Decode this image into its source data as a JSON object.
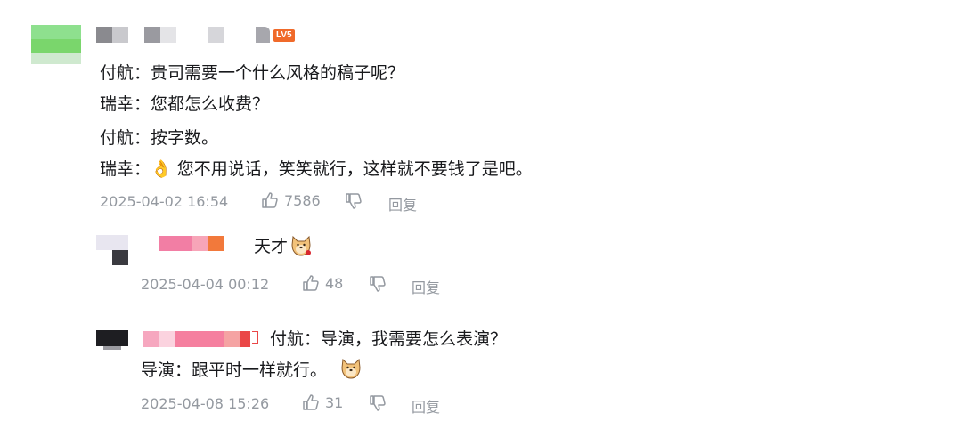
{
  "comments": [
    {
      "level_badge": "LV5",
      "lines": [
        "付航：贵司需要一个什么风格的稿子呢？",
        "瑞幸：您都怎么收费？",
        "付航：按字数。",
        "瑞幸：👌 您不用说话，笑笑就行，这样就不要钱了是吧。"
      ],
      "time": "2025-04-02 16:54",
      "likes": "7586",
      "reply_label": "回复"
    }
  ],
  "replies": [
    {
      "text": "天才",
      "time": "2025-04-04 00:12",
      "likes": "48",
      "reply_label": "回复"
    },
    {
      "lines": [
        "付航：导演，我需要怎么表演？",
        "导演：跟平时一样就行。"
      ],
      "time": "2025-04-08 15:26",
      "likes": "31",
      "reply_label": "回复"
    }
  ],
  "colors": {
    "text": "#18191c",
    "meta": "#9499a0",
    "badge": "#f06a2a",
    "username_pink": "#fb7299"
  }
}
